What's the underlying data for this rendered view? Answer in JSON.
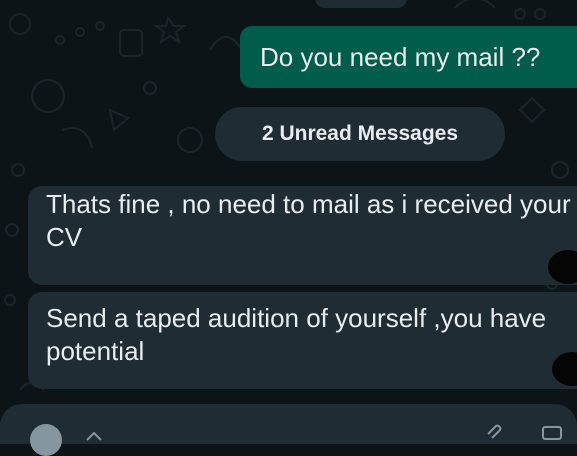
{
  "chat": {
    "outgoing_message": "Do you need my mail ??",
    "unread_divider": "2 Unread Messages",
    "incoming_messages": [
      "Thats fine , no need to mail as i received your CV",
      "Send a taped audition of yourself  ,you have potential"
    ]
  },
  "icons": {
    "wallpaper": "doodle-pattern",
    "composer_left": "emoji-icon",
    "composer_attach": "chevron-icon",
    "composer_right": "paperclip-icon"
  },
  "colors": {
    "background": "#0d1418",
    "outgoing_bubble": "#005c4b",
    "incoming_bubble": "#1f2c34",
    "text": "#e9edef"
  }
}
